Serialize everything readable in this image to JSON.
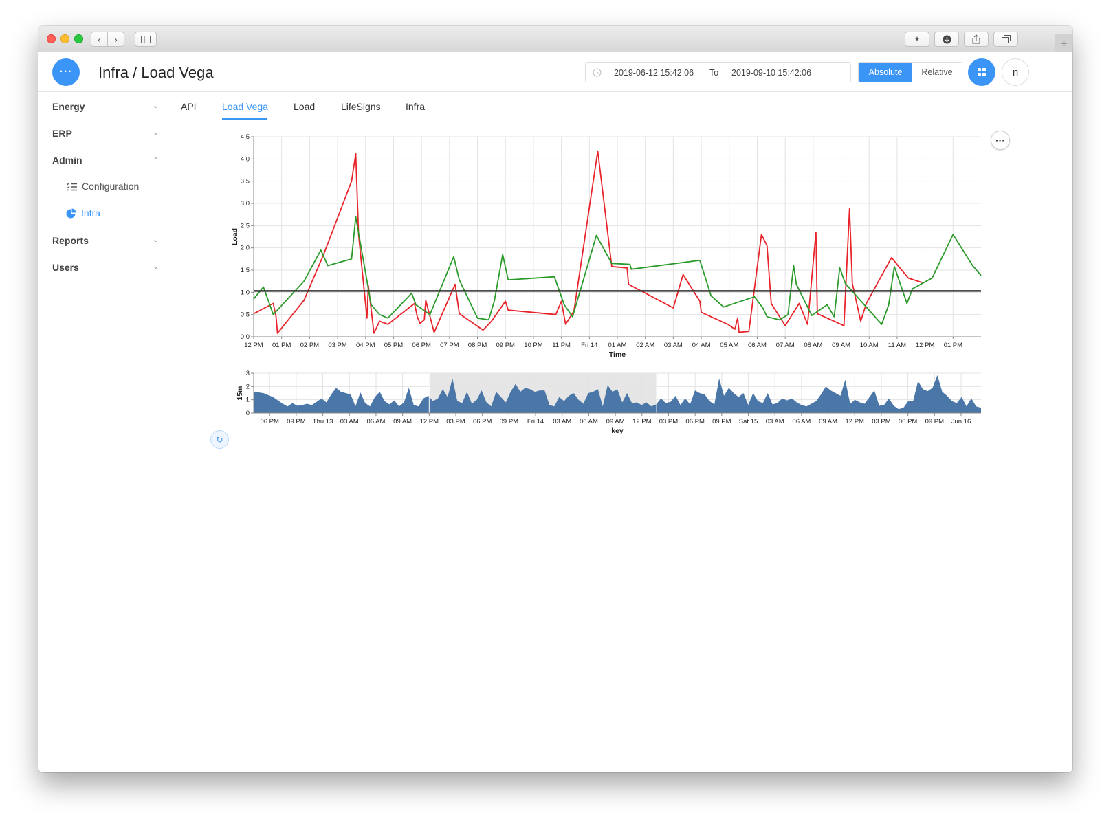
{
  "app": {
    "title": "Infra / Load Vega",
    "menu_icon": "ellipsis-icon"
  },
  "daterange": {
    "from": "2019-06-12 15:42:06",
    "to_label": "To",
    "to": "2019-09-10 15:42:06"
  },
  "mode_toggle": {
    "absolute": "Absolute",
    "relative": "Relative",
    "selected": "Absolute"
  },
  "user": {
    "initial": "n"
  },
  "colors": {
    "accent": "#3a95f6",
    "series_red": "#e8232a",
    "series_green": "#2a9a2a",
    "threshold": "#333333",
    "area": "#4a76a8"
  },
  "sidebar": {
    "items": [
      {
        "label": "Energy",
        "expanded": false
      },
      {
        "label": "ERP",
        "expanded": false
      },
      {
        "label": "Admin",
        "expanded": true,
        "children": [
          {
            "label": "Configuration",
            "icon": "list-check-icon",
            "active": false
          },
          {
            "label": "Infra",
            "icon": "pie-chart-icon",
            "active": true
          }
        ]
      },
      {
        "label": "Reports",
        "expanded": false
      },
      {
        "label": "Users",
        "expanded": false
      }
    ]
  },
  "tabs": [
    {
      "label": "API",
      "active": false
    },
    {
      "label": "Load Vega",
      "active": true
    },
    {
      "label": "Load",
      "active": false
    },
    {
      "label": "LifeSigns",
      "active": false
    },
    {
      "label": "Infra",
      "active": false
    }
  ],
  "chart_data": [
    {
      "type": "line",
      "title": "",
      "xlabel": "Time",
      "ylabel": "Load",
      "ylim": [
        0,
        4.5
      ],
      "grid": true,
      "yticks": [
        "0.0",
        "0.5",
        "1.0",
        "1.5",
        "2.0",
        "2.5",
        "3.0",
        "3.5",
        "4.0",
        "4.5"
      ],
      "xticks": [
        "12 PM",
        "01 PM",
        "02 PM",
        "03 PM",
        "04 PM",
        "05 PM",
        "06 PM",
        "07 PM",
        "08 PM",
        "09 PM",
        "10 PM",
        "11 PM",
        "Fri 14",
        "01 AM",
        "02 AM",
        "03 AM",
        "04 AM",
        "05 AM",
        "06 AM",
        "07 AM",
        "08 AM",
        "09 AM",
        "10 AM",
        "11 AM",
        "12 PM",
        "01 PM"
      ],
      "x_unit": "hours after 12 PM (Thu 13)",
      "threshold": 1.03,
      "series": [
        {
          "color": "#e8232a",
          "points": [
            [
              0,
              0.52
            ],
            [
              0.7,
              0.75
            ],
            [
              0.8,
              0.45
            ],
            [
              0.85,
              0.08
            ],
            [
              1.8,
              0.82
            ],
            [
              2.5,
              1.85
            ],
            [
              3.5,
              3.5
            ],
            [
              3.65,
              4.12
            ],
            [
              3.75,
              2.3
            ],
            [
              4.05,
              0.42
            ],
            [
              4.1,
              1.15
            ],
            [
              4.3,
              0.08
            ],
            [
              4.5,
              0.35
            ],
            [
              4.8,
              0.28
            ],
            [
              5.75,
              0.75
            ],
            [
              5.85,
              0.45
            ],
            [
              5.95,
              0.3
            ],
            [
              6.1,
              0.38
            ],
            [
              6.15,
              0.82
            ],
            [
              6.45,
              0.1
            ],
            [
              7.2,
              1.18
            ],
            [
              7.35,
              0.52
            ],
            [
              8.2,
              0.15
            ],
            [
              8.5,
              0.35
            ],
            [
              9.0,
              0.8
            ],
            [
              9.1,
              0.6
            ],
            [
              10.8,
              0.5
            ],
            [
              11.0,
              0.8
            ],
            [
              11.15,
              0.28
            ],
            [
              11.45,
              0.58
            ],
            [
              12.3,
              4.18
            ],
            [
              12.8,
              1.58
            ],
            [
              13.35,
              1.55
            ],
            [
              13.4,
              1.18
            ],
            [
              15.0,
              0.65
            ],
            [
              15.35,
              1.4
            ],
            [
              15.95,
              0.8
            ],
            [
              16.0,
              0.55
            ],
            [
              16.95,
              0.28
            ],
            [
              17.2,
              0.17
            ],
            [
              17.3,
              0.42
            ],
            [
              17.35,
              0.1
            ],
            [
              17.7,
              0.12
            ],
            [
              18.15,
              2.3
            ],
            [
              18.35,
              2.05
            ],
            [
              18.5,
              0.75
            ],
            [
              19.0,
              0.25
            ],
            [
              19.5,
              0.75
            ],
            [
              19.8,
              0.28
            ],
            [
              20.1,
              2.35
            ],
            [
              20.15,
              0.52
            ],
            [
              21.1,
              0.25
            ],
            [
              21.3,
              2.88
            ],
            [
              21.4,
              1.2
            ],
            [
              21.7,
              0.35
            ],
            [
              21.9,
              0.75
            ],
            [
              22.8,
              1.78
            ],
            [
              23.4,
              1.32
            ],
            [
              23.9,
              1.22
            ]
          ]
        },
        {
          "color": "#2a9a2a",
          "points": [
            [
              0,
              0.85
            ],
            [
              0.35,
              1.12
            ],
            [
              0.7,
              0.5
            ],
            [
              1.8,
              1.25
            ],
            [
              2.4,
              1.95
            ],
            [
              2.65,
              1.6
            ],
            [
              3.5,
              1.75
            ],
            [
              3.65,
              2.7
            ],
            [
              4.2,
              0.72
            ],
            [
              4.5,
              0.5
            ],
            [
              4.8,
              0.42
            ],
            [
              5.65,
              0.98
            ],
            [
              5.8,
              0.72
            ],
            [
              6.3,
              0.5
            ],
            [
              7.15,
              1.8
            ],
            [
              7.35,
              1.28
            ],
            [
              8.0,
              0.42
            ],
            [
              8.4,
              0.38
            ],
            [
              8.6,
              0.8
            ],
            [
              8.9,
              1.85
            ],
            [
              9.1,
              1.28
            ],
            [
              10.75,
              1.35
            ],
            [
              11.1,
              0.72
            ],
            [
              11.4,
              0.45
            ],
            [
              12.25,
              2.28
            ],
            [
              12.8,
              1.65
            ],
            [
              13.45,
              1.63
            ],
            [
              13.5,
              1.52
            ],
            [
              15.95,
              1.72
            ],
            [
              16.35,
              0.92
            ],
            [
              16.8,
              0.67
            ],
            [
              17.9,
              0.9
            ],
            [
              18.2,
              0.65
            ],
            [
              18.35,
              0.45
            ],
            [
              18.8,
              0.38
            ],
            [
              19.1,
              0.5
            ],
            [
              19.3,
              1.6
            ],
            [
              19.4,
              1.18
            ],
            [
              19.95,
              0.48
            ],
            [
              20.5,
              0.72
            ],
            [
              20.75,
              0.45
            ],
            [
              20.95,
              1.55
            ],
            [
              21.15,
              1.2
            ],
            [
              22.45,
              0.28
            ],
            [
              22.7,
              0.72
            ],
            [
              22.9,
              1.58
            ],
            [
              23.35,
              0.75
            ],
            [
              23.55,
              1.08
            ],
            [
              24.25,
              1.32
            ],
            [
              25.0,
              2.3
            ],
            [
              25.7,
              1.6
            ],
            [
              26.0,
              1.38
            ]
          ]
        }
      ]
    },
    {
      "type": "area",
      "xlabel": "key",
      "ylabel": "15m",
      "ylim": [
        0,
        3
      ],
      "grid": true,
      "yticks": [
        "0",
        "1",
        "2",
        "3"
      ],
      "xticks": [
        "06 PM",
        "09 PM",
        "Thu 13",
        "03 AM",
        "06 AM",
        "09 AM",
        "12 PM",
        "03 PM",
        "06 PM",
        "09 PM",
        "Fri 14",
        "03 AM",
        "06 AM",
        "09 AM",
        "12 PM",
        "03 PM",
        "06 PM",
        "09 PM",
        "Sat 15",
        "03 AM",
        "06 AM",
        "09 AM",
        "12 PM",
        "03 PM",
        "06 PM",
        "09 PM",
        "Jun 16"
      ],
      "brush": {
        "from": "12 PM",
        "to": "12 PM"
      },
      "color": "#4a76a8",
      "values": [
        1.6,
        1.55,
        1.5,
        1.35,
        1.2,
        0.95,
        0.7,
        0.5,
        0.75,
        0.55,
        0.6,
        0.7,
        0.6,
        0.85,
        1.1,
        0.8,
        1.4,
        1.9,
        1.6,
        1.5,
        1.4,
        0.5,
        1.55,
        0.75,
        0.5,
        1.2,
        1.6,
        0.9,
        0.65,
        0.95,
        0.5,
        0.8,
        1.9,
        0.6,
        0.5,
        1.1,
        1.3,
        0.9,
        1.1,
        1.8,
        1.2,
        2.6,
        0.9,
        0.75,
        1.6,
        0.7,
        1.0,
        1.7,
        0.8,
        0.5,
        1.6,
        1.2,
        0.8,
        1.6,
        2.2,
        1.6,
        1.9,
        1.8,
        1.6,
        1.7,
        1.7,
        0.6,
        0.5,
        1.2,
        0.9,
        1.3,
        1.5,
        1.0,
        0.7,
        1.5,
        1.6,
        1.8,
        0.5,
        2.1,
        1.6,
        1.8,
        0.8,
        1.5,
        0.75,
        0.8,
        0.6,
        0.8,
        0.5,
        0.65,
        1.1,
        0.75,
        0.85,
        1.3,
        0.6,
        1.1,
        0.65,
        1.7,
        1.5,
        1.4,
        0.9,
        0.65,
        2.6,
        1.3,
        1.9,
        1.5,
        1.2,
        1.5,
        0.6,
        1.5,
        0.9,
        0.75,
        1.5,
        0.65,
        0.75,
        1.1,
        0.95,
        1.1,
        0.8,
        0.6,
        0.5,
        0.7,
        0.9,
        1.4,
        2.0,
        1.7,
        1.5,
        1.3,
        2.5,
        0.7,
        1.0,
        0.8,
        0.7,
        1.2,
        1.7,
        0.55,
        0.6,
        1.1,
        0.55,
        0.3,
        0.4,
        0.9,
        0.9,
        2.4,
        1.8,
        1.65,
        1.9,
        2.85,
        1.6,
        1.3,
        0.9,
        0.75,
        1.2,
        0.5,
        1.1,
        0.5,
        0.4
      ]
    }
  ]
}
